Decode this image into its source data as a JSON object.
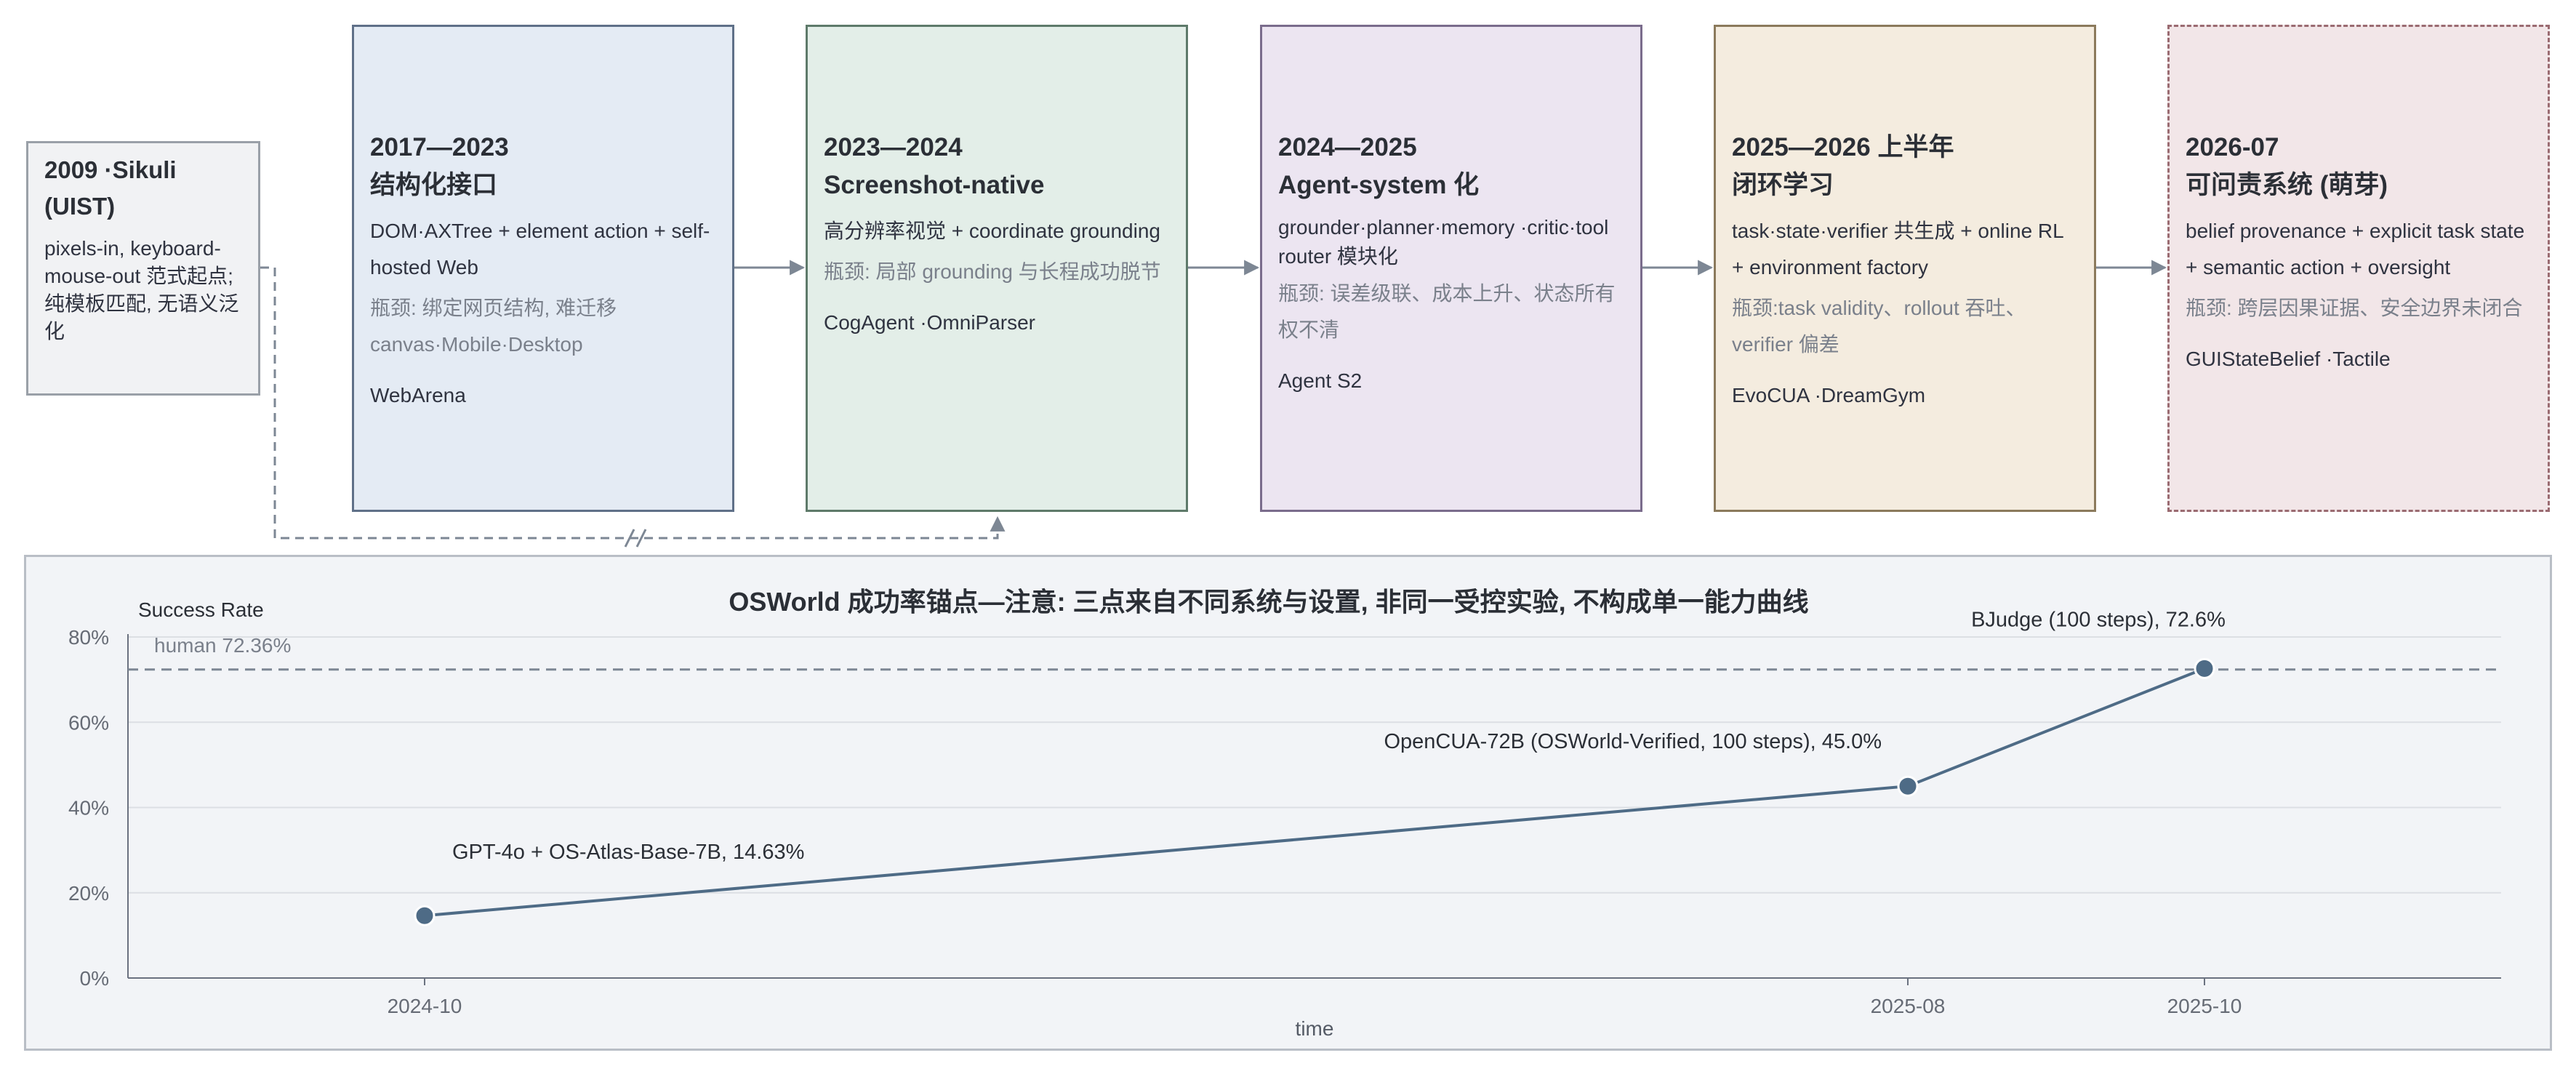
{
  "origin": {
    "title": "2009 ·Sikuli (UIST)",
    "desc": "pixels-in, keyboard-mouse-out 范式起点; 纯模板匹配, 无语义泛化"
  },
  "cards": [
    {
      "title_line1": "2017—2023",
      "title_line2": "结构化接口",
      "desc": "DOM·AXTree + element action + self-hosted Web",
      "bottleneck": "瓶颈: 绑定网页结构, 难迁移 canvas·Mobile·Desktop",
      "refs": "WebArena",
      "color": "#5f7088"
    },
    {
      "title_line1": "2023—2024",
      "title_line2": "Screenshot-native",
      "desc": "高分辨率视觉 + coordinate grounding",
      "bottleneck": "瓶颈: 局部 grounding 与长程成功脱节",
      "refs": "CogAgent ·OmniParser",
      "color": "#5e7a6a"
    },
    {
      "title_line1": "2024—2025",
      "title_line2": "Agent-system 化",
      "desc": "grounder·planner·memory ·critic·tool router 模块化",
      "bottleneck": "瓶颈: 误差级联、成本上升、状态所有权不清",
      "refs": "Agent S2",
      "color": "#7a6c8c"
    },
    {
      "title_line1": "2025—2026 上半年",
      "title_line2": "闭环学习",
      "desc": "task·state·verifier 共生成 + online RL + environment factory",
      "bottleneck": "瓶颈:task validity、rollout 吞吐、verifier 偏差",
      "refs": "EvoCUA ·DreamGym",
      "color": "#8b7a5c"
    },
    {
      "title_line1": "2026-07",
      "title_line2": "可问责系统 (萌芽)",
      "desc": "belief provenance + explicit task state + semantic action + oversight",
      "bottleneck": "瓶颈: 跨层因果证据、安全边界未闭合",
      "refs": "GUIStateBelief ·Tactile",
      "color": "#9a6b71"
    }
  ],
  "chart_data": {
    "type": "line",
    "title": "OSWorld 成功率锚点—注意: 三点来自不同系统与设置, 非同一受控实验, 不构成单一能力曲线",
    "xlabel": "time",
    "ylabel": "Success Rate",
    "x_ticks": [
      "2024-10",
      "2025-08",
      "2025-10"
    ],
    "y_ticks": [
      "0%",
      "20%",
      "40%",
      "60%",
      "80%"
    ],
    "ylim": [
      0,
      80
    ],
    "grid": true,
    "points": [
      {
        "x": "2024-10",
        "y": 14.63,
        "label": "GPT-4o + OS-Atlas-Base-7B, 14.63%"
      },
      {
        "x": "2025-08",
        "y": 45.0,
        "label": "OpenCUA-72B (OSWorld-Verified, 100 steps), 45.0%"
      },
      {
        "x": "2025-10",
        "y": 72.6,
        "label": "BJudge (100 steps), 72.6%"
      }
    ],
    "reference_line": {
      "y": 72.36,
      "label": "human 72.36%"
    },
    "line_color": "#4e6b86"
  }
}
